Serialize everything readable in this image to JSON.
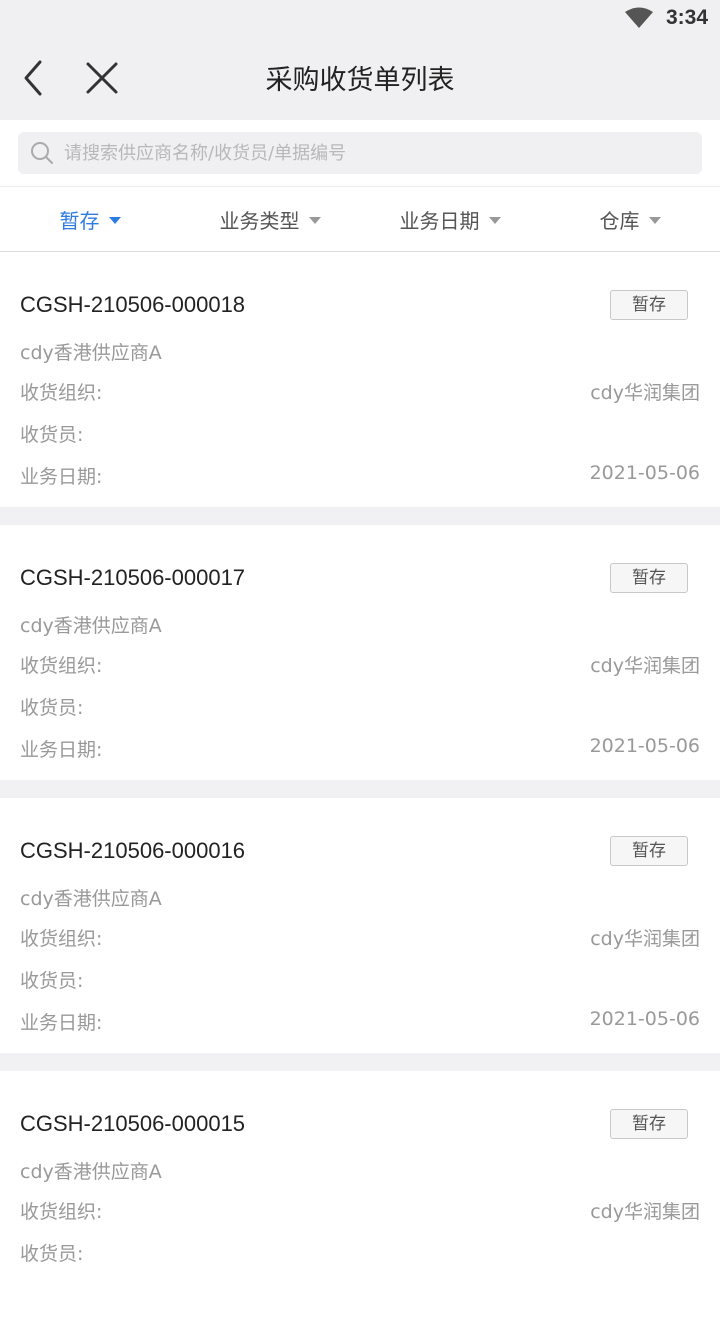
{
  "status_bar": {
    "time": "3:34",
    "wifi_icon": "wifi-icon"
  },
  "header": {
    "title": "采购收货单列表",
    "back_icon": "back-arrow-icon",
    "close_icon": "close-icon"
  },
  "search": {
    "placeholder": "请搜索供应商名称/收货员/单据编号",
    "value": "",
    "icon": "search-icon"
  },
  "filters": [
    {
      "label": "暂存",
      "active": true
    },
    {
      "label": "业务类型",
      "active": false
    },
    {
      "label": "业务日期",
      "active": false
    },
    {
      "label": "仓库",
      "active": false
    }
  ],
  "colors": {
    "accent": "#2f7be5",
    "muted_text": "#999999",
    "background_gray": "#f0f0f2"
  },
  "labels": {
    "org": "收货组织:",
    "receiver": "收货员:",
    "date": "业务日期:"
  },
  "orders": [
    {
      "no": "CGSH-210506-000018",
      "status": "暂存",
      "supplier": "cdy香港供应商A",
      "org": "cdy华润集团",
      "receiver": "",
      "date": "2021-05-06"
    },
    {
      "no": "CGSH-210506-000017",
      "status": "暂存",
      "supplier": "cdy香港供应商A",
      "org": "cdy华润集团",
      "receiver": "",
      "date": "2021-05-06"
    },
    {
      "no": "CGSH-210506-000016",
      "status": "暂存",
      "supplier": "cdy香港供应商A",
      "org": "cdy华润集团",
      "receiver": "",
      "date": "2021-05-06"
    },
    {
      "no": "CGSH-210506-000015",
      "status": "暂存",
      "supplier": "cdy香港供应商A",
      "org": "cdy华润集团",
      "receiver": "",
      "date": ""
    }
  ]
}
